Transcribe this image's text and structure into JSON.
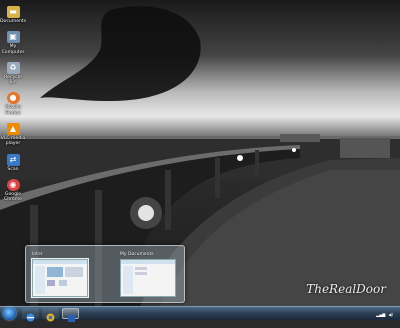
{
  "desktop_icons": [
    {
      "label": "Documents",
      "icon": "folder-icon",
      "color": "#d9b24a"
    },
    {
      "label": "My\nComputer",
      "icon": "computer-icon",
      "color": "#6f8fb0"
    },
    {
      "label": "Recycle Bin",
      "icon": "recycle-bin-icon",
      "color": "#9ab"
    },
    {
      "label": "Mozilla\nFirefox",
      "icon": "firefox-icon",
      "color": "#e8732a"
    },
    {
      "label": "VLC media\nplayer",
      "icon": "vlc-icon",
      "color": "#f08a00"
    },
    {
      "label": "Scan",
      "icon": "scan-icon",
      "color": "#3a79c9"
    },
    {
      "label": "Google\nChrome",
      "icon": "chrome-icon",
      "color": "#d44"
    }
  ],
  "thumbnails": [
    {
      "title": "Intel",
      "active": true
    },
    {
      "title": "My Documents",
      "active": false
    }
  ],
  "watermark": "TheRealDoor",
  "taskbar": {
    "pinned": [
      "internet-explorer-icon",
      "chrome-icon",
      "word-icon"
    ],
    "active_index": 2,
    "clock_time": "",
    "clock_date": ""
  },
  "colors": {
    "taskbar": "#2b3e52",
    "thumb_border": "#ffffff"
  }
}
